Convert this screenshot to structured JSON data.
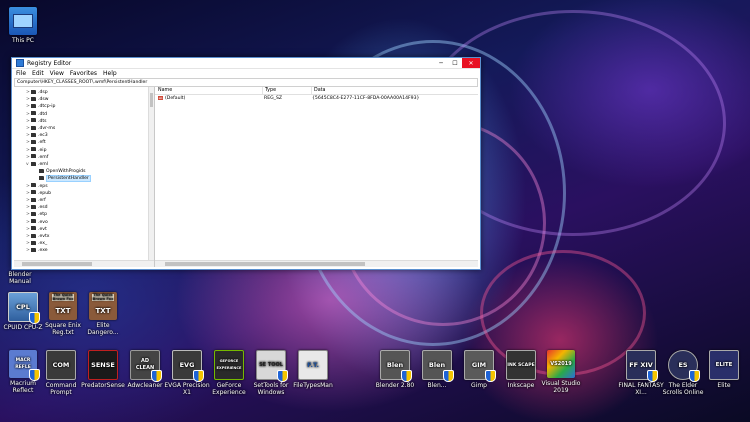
{
  "desktop": {
    "left_icons": [
      {
        "label": "This PC",
        "icon": "this-pc-icon"
      },
      {
        "label": "Blender Manual",
        "icon": "blender-manual-icon"
      }
    ],
    "row1": [
      {
        "label": "CPUID CPU-Z",
        "icon_text": "CPL",
        "icon": "cpuz-icon",
        "shield": true
      },
      {
        "label": "Square Enix Reg.txt",
        "icon_text": "TXT",
        "icon": "text-file-icon",
        "paper_text": "The Quick Brown Fox"
      },
      {
        "label": "Elite Dangero...",
        "icon_text": "TXT",
        "icon": "text-file-icon",
        "paper_text": "The Quick Brown Fox"
      }
    ],
    "row2": [
      {
        "label": "Macrium Reflect",
        "icon_text": "MACR REFLE",
        "icon": "macrium-icon",
        "shield": true
      },
      {
        "label": "Command Prompt",
        "icon_text": "COM",
        "icon": "command-prompt-icon"
      },
      {
        "label": "PredatorSense",
        "icon_text": "SENSE",
        "icon": "predatorsense-icon"
      },
      {
        "label": "Adwcleaner",
        "icon_text": "AD CLEAN",
        "icon": "adwcleaner-icon",
        "shield": true
      },
      {
        "label": "EVGA Precision X1",
        "icon_text": "EVG",
        "icon": "evga-icon",
        "shield": true
      },
      {
        "label": "GeForce Experience",
        "icon_text": "GEFORCE EXPERIENCE",
        "icon": "geforce-icon"
      },
      {
        "label": "SetTools for Windows",
        "icon_text": "SE TOOL",
        "icon": "settools-icon",
        "shield": true
      },
      {
        "label": "FileTypesMan",
        "icon_text": "F.T.",
        "icon": "filetypesman-icon"
      },
      {
        "label": "Blender 2.80",
        "icon_text": "Blen",
        "icon": "blender-icon",
        "shield": true
      },
      {
        "label": "Blen...",
        "icon_text": "Blen",
        "icon": "blender-icon",
        "shield": true
      },
      {
        "label": "Gimp",
        "icon_text": "GIM",
        "icon": "gimp-icon",
        "shield": true
      },
      {
        "label": "Inkscape",
        "icon_text": "INK SCAPE",
        "icon": "inkscape-icon"
      },
      {
        "label": "Visual Studio 2019",
        "icon_text": "VS2019",
        "icon": "visual-studio-icon"
      },
      {
        "label": "FINAL FANTASY XI...",
        "icon_text": "FF XIV",
        "icon": "ffxiv-icon",
        "shield": true
      },
      {
        "label": "The Elder Scrolls Online",
        "icon_text": "ES",
        "icon": "eso-icon",
        "shield": true
      },
      {
        "label": "Elite",
        "icon_text": "ELITE",
        "icon": "elite-icon"
      }
    ]
  },
  "window": {
    "title": "Registry Editor",
    "controls": {
      "minimize": "─",
      "maximize": "☐",
      "close": "✕"
    },
    "menu": [
      "File",
      "Edit",
      "View",
      "Favorites",
      "Help"
    ],
    "address": "Computer\\HKEY_CLASSES_ROOT\\.wmf\\PersistentHandler",
    "tree": [
      {
        "label": ".dsp",
        "indent": 1,
        "exp": ">"
      },
      {
        "label": ".dsw",
        "indent": 1,
        "exp": ">"
      },
      {
        "label": ".dtcp-ip",
        "indent": 1,
        "exp": ">"
      },
      {
        "label": ".dtd",
        "indent": 1,
        "exp": ">"
      },
      {
        "label": ".dts",
        "indent": 1,
        "exp": ">"
      },
      {
        "label": ".dvr-ms",
        "indent": 1,
        "exp": ">"
      },
      {
        "label": ".ec3",
        "indent": 1,
        "exp": ">"
      },
      {
        "label": ".eft",
        "indent": 1,
        "exp": ">"
      },
      {
        "label": ".eip",
        "indent": 1,
        "exp": ">"
      },
      {
        "label": ".emf",
        "indent": 1,
        "exp": ">"
      },
      {
        "label": ".eml",
        "indent": 1,
        "exp": "v"
      },
      {
        "label": "OpenWithProgids",
        "indent": 2,
        "exp": ""
      },
      {
        "label": "PersistentHandler",
        "indent": 2,
        "exp": "",
        "selected": true
      },
      {
        "label": ".eps",
        "indent": 1,
        "exp": ">"
      },
      {
        "label": ".epub",
        "indent": 1,
        "exp": ">"
      },
      {
        "label": ".erf",
        "indent": 1,
        "exp": ">"
      },
      {
        "label": ".esd",
        "indent": 1,
        "exp": ">"
      },
      {
        "label": ".etp",
        "indent": 1,
        "exp": ">"
      },
      {
        "label": ".evo",
        "indent": 1,
        "exp": ">"
      },
      {
        "label": ".evt",
        "indent": 1,
        "exp": ">"
      },
      {
        "label": ".evtx",
        "indent": 1,
        "exp": ">"
      },
      {
        "label": ".ex_",
        "indent": 1,
        "exp": ">"
      },
      {
        "label": ".exe",
        "indent": 1,
        "exp": ">"
      }
    ],
    "columns": {
      "name": "Name",
      "type": "Type",
      "data": "Data"
    },
    "values": [
      {
        "name": "(Default)",
        "type": "REG_SZ",
        "data": "{5645C8C4-E277-11CF-8FDA-00AA00A14F93}"
      }
    ]
  }
}
